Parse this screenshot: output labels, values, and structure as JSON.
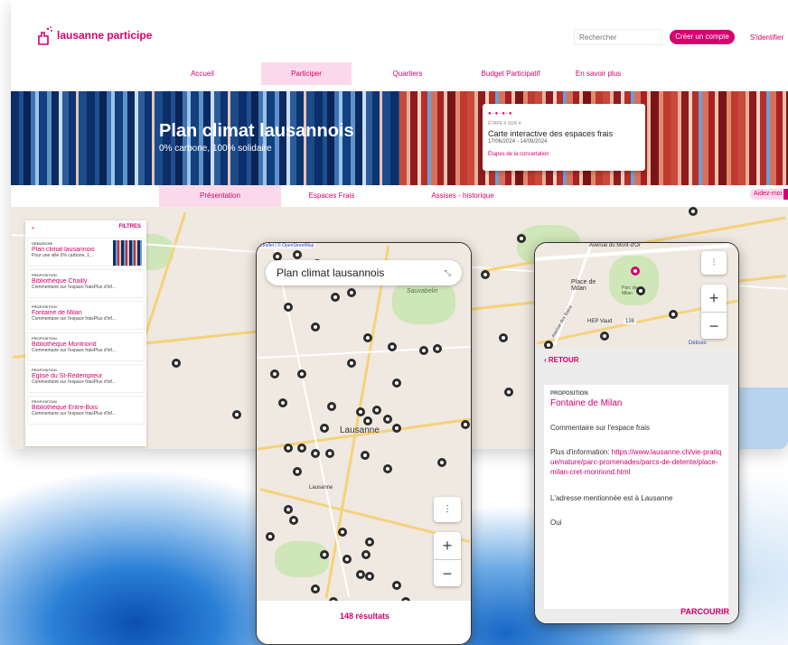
{
  "brand": {
    "name": "lausanne participe",
    "accent": "#d6006e"
  },
  "header": {
    "search_placeholder": "Rechercher",
    "create_account": "Créer un compte",
    "login": "S'identifier"
  },
  "nav": {
    "items": [
      {
        "label": "Accueil"
      },
      {
        "label": "Participer"
      },
      {
        "label": "Quartiers"
      },
      {
        "label": "Budget Participatif"
      },
      {
        "label": "En savoir plus"
      }
    ],
    "active": "Participer"
  },
  "hero": {
    "title": "Plan climat lausannois",
    "subtitle": "0% carbone, 100% solidaire",
    "stage": {
      "dots": "●-●-●-●",
      "step": "ÉTAPE 4 SUR 4",
      "title": "Carte interactive des espaces frais",
      "dates": "17/06/2024 - 14/09/2024",
      "link": "Étapes de la concertation"
    }
  },
  "subnav": {
    "items": [
      {
        "label": "Présentation"
      },
      {
        "label": "Espaces Frais"
      },
      {
        "label": "Assises - historique"
      }
    ],
    "active": "Présentation",
    "help": "Aidez-moi"
  },
  "sidebar": {
    "filters": "FILTRES",
    "items": [
      {
        "kind": "DÉMARCHE",
        "title": "Plan climat lausannois",
        "desc": "Pour une ville 0% carbone, 1..."
      },
      {
        "kind": "PROPOSITION",
        "title": "Bibliothèque Chailly",
        "desc": "Commentaire sur l'espace fraisPlus d'inf..."
      },
      {
        "kind": "PROPOSITION",
        "title": "Fontaine de Milan",
        "desc": "Commentaire sur l'espace fraisPlus d'inf..."
      },
      {
        "kind": "PROPOSITION",
        "title": "Bibliothèque Montriond",
        "desc": "Commentaire sur l'espace fraisPlus d'inf..."
      },
      {
        "kind": "PROPOSITION",
        "title": "Eglise du St-Rédempteur",
        "desc": "Commentaire sur l'espace fraisPlus d'inf..."
      },
      {
        "kind": "PROPOSITION",
        "title": "Bibliothèque Entre-Bois",
        "desc": "Commentaire sur l'espace fraisPlus d'inf..."
      }
    ]
  },
  "phone_map": {
    "credit": "Leaflet | © OpenStreetMap",
    "title": "Plan climat lausannois",
    "place_labels": [
      "Sauvabelin",
      "Lausanne",
      "Lausanne"
    ],
    "zoom_in": "+",
    "zoom_out": "−",
    "results": "148 résultats"
  },
  "phone_detail": {
    "map_labels": [
      "Avenue du Mont-d'Or",
      "Place de Milan",
      "Parc de Milan",
      "HEP Vaud",
      "138",
      "Délices",
      "Avenue des Bains"
    ],
    "back": "RETOUR",
    "kind": "PROPOSITION",
    "title": "Fontaine de Milan",
    "comment": "Commentaire sur l'espace frais",
    "more_label": "Plus d'information: ",
    "more_url": "https://www.lausanne.ch/vie-pratique/nature/parc-promenades/parcs-de-detente/place-milan-cret-monriond.html",
    "address": "L'adresse mentionnée est à Lausanne",
    "answer": "Oui",
    "browse": "PARCOURIR"
  }
}
